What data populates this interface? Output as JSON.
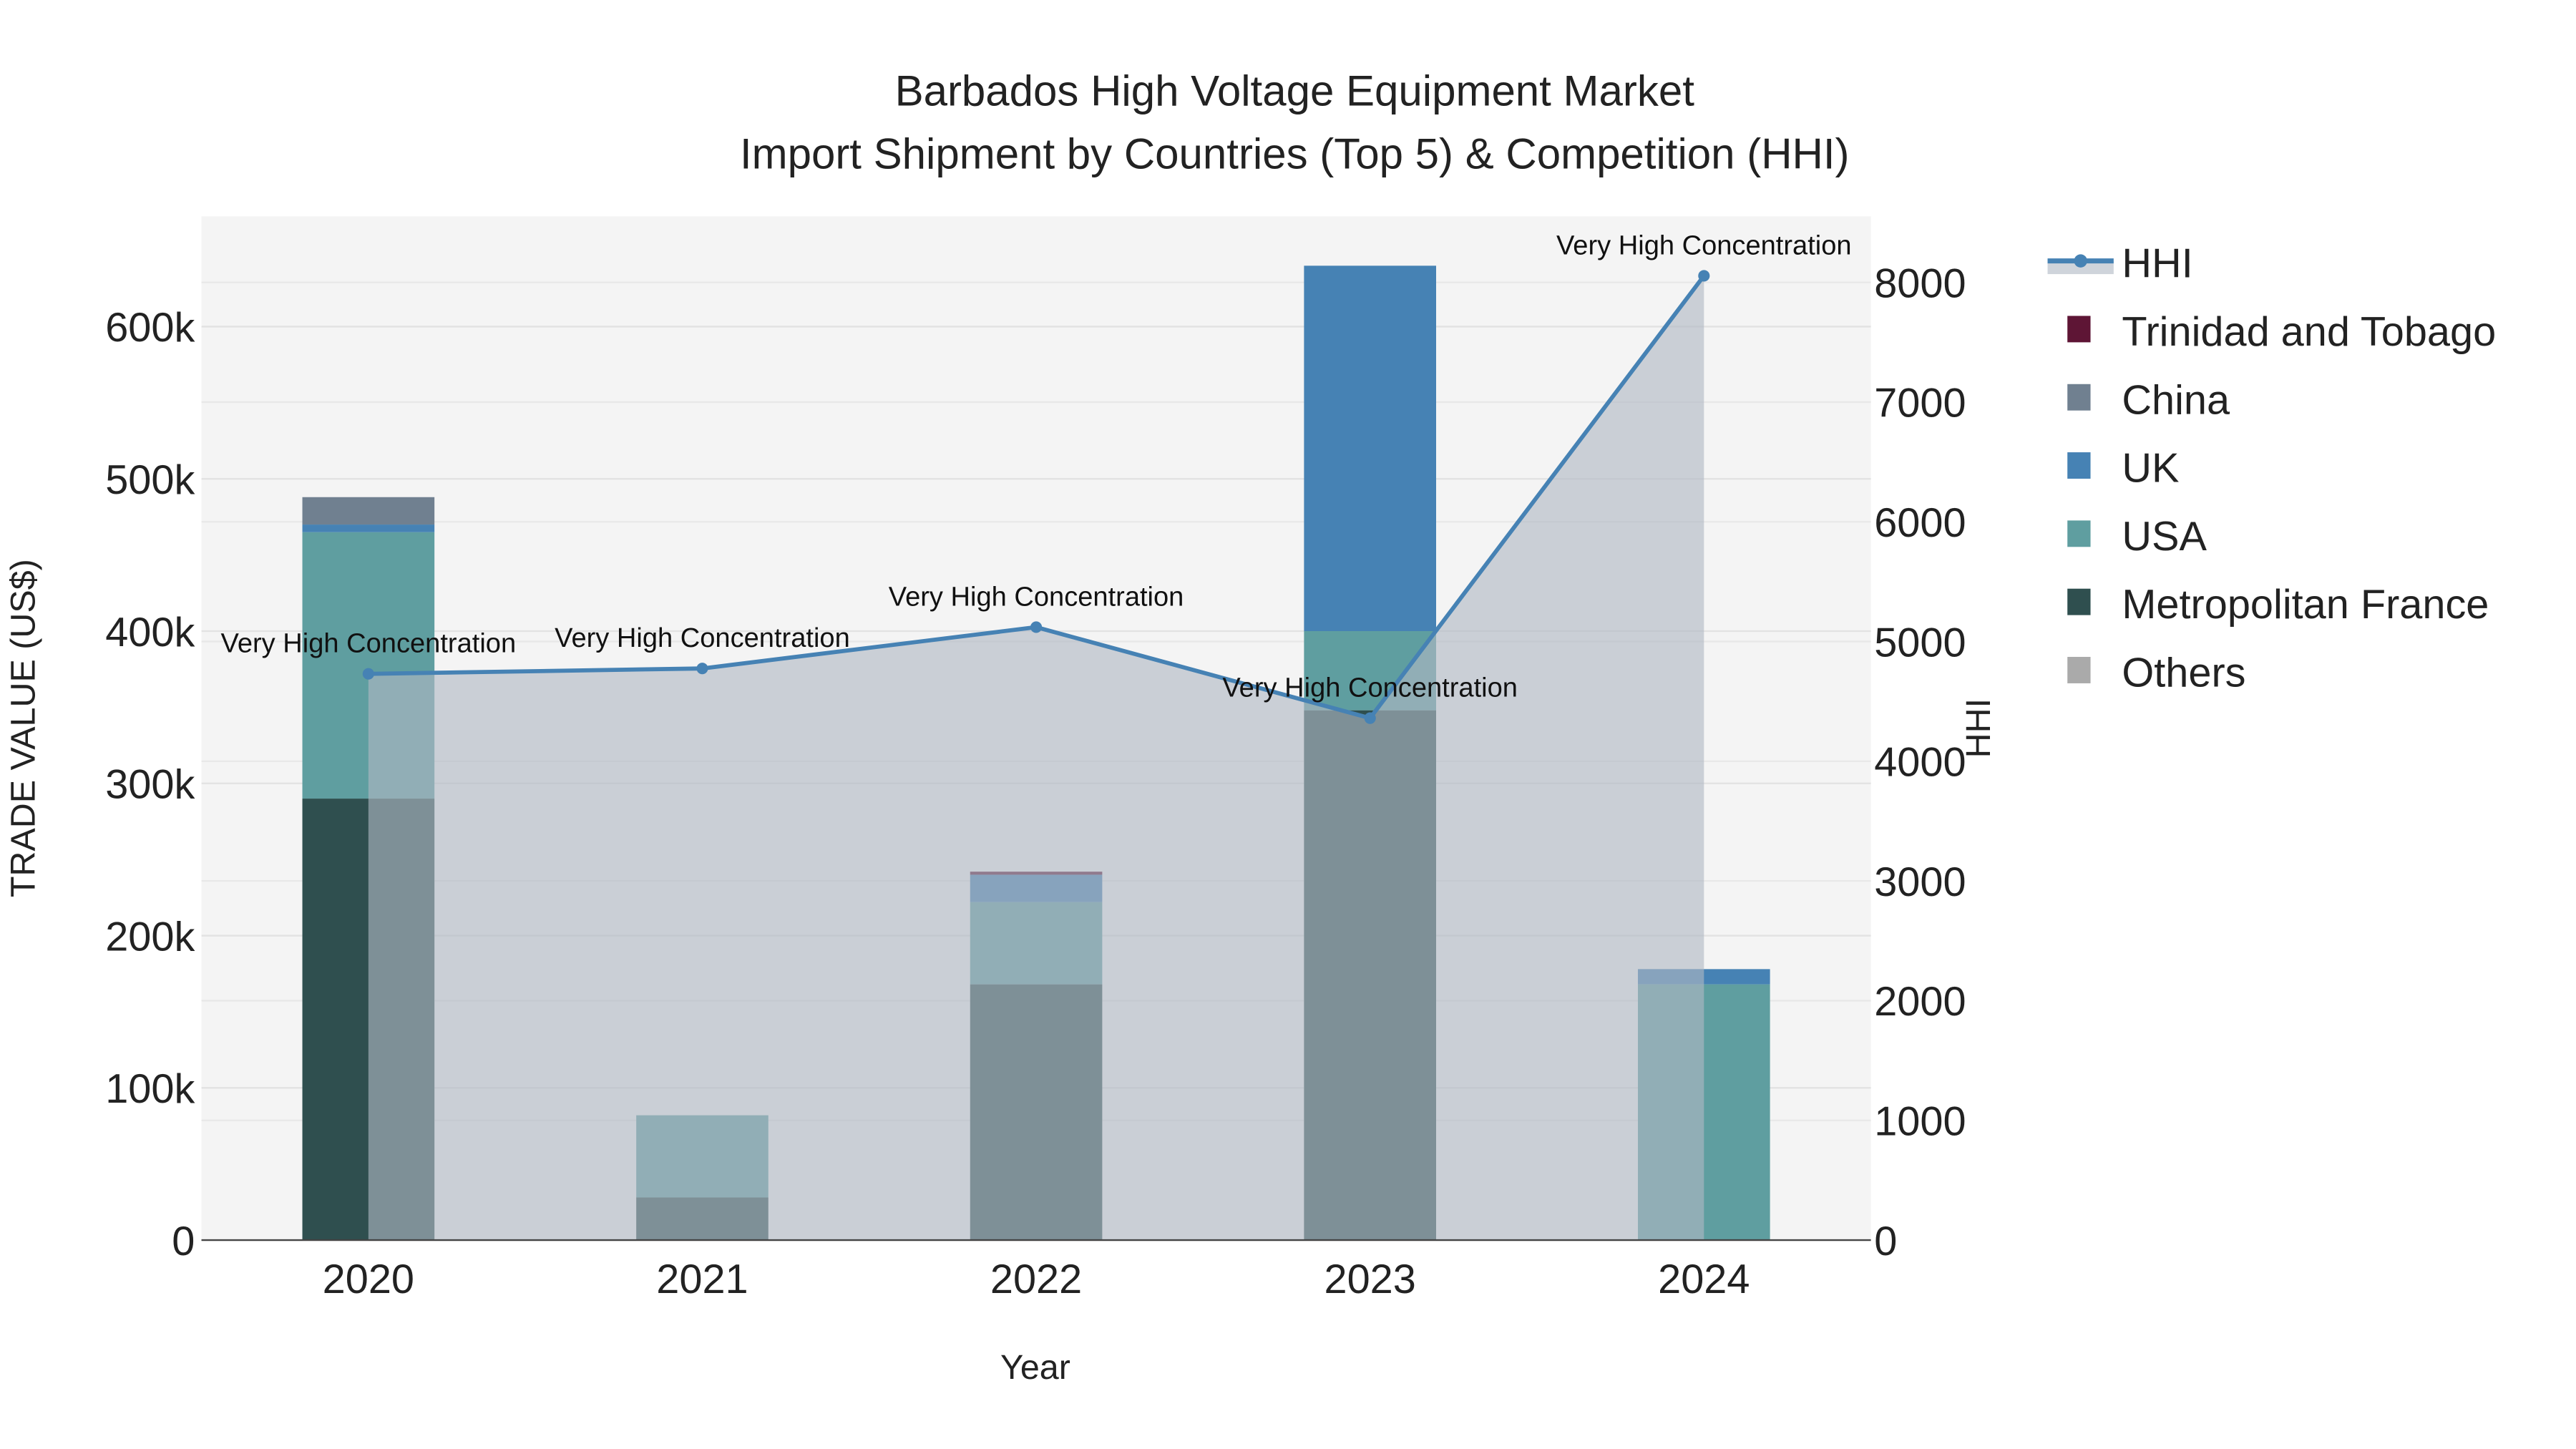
{
  "chart_data": {
    "type": "bar",
    "title": "Barbados High Voltage Equipment Market",
    "subtitle": "Import Shipment by Countries (Top 5) & Competition (HHI)",
    "xlabel": "Year",
    "ylabel": "TRADE VALUE (US$)",
    "y2label": "HHI",
    "categories": [
      "2020",
      "2021",
      "2022",
      "2023",
      "2024"
    ],
    "ylim": [
      0,
      670000
    ],
    "y_ticks": [
      0,
      100000,
      200000,
      300000,
      400000,
      500000,
      600000
    ],
    "y_tick_labels": [
      "0",
      "100k",
      "200k",
      "300k",
      "400k",
      "500k",
      "600k"
    ],
    "y2lim": [
      0,
      8550
    ],
    "y2_ticks": [
      0,
      1000,
      2000,
      3000,
      4000,
      5000,
      6000,
      7000,
      8000
    ],
    "y2_tick_labels": [
      "0",
      "1000",
      "2000",
      "3000",
      "4000",
      "5000",
      "6000",
      "7000",
      "8000"
    ],
    "stacked": true,
    "series": [
      {
        "name": "Metropolitan France",
        "color": "#2f4f4f",
        "values": [
          290000,
          28000,
          168000,
          348000,
          0
        ]
      },
      {
        "name": "USA",
        "color": "#5f9ea0",
        "values": [
          175000,
          54000,
          54000,
          52000,
          168000
        ]
      },
      {
        "name": "UK",
        "color": "#4682b4",
        "values": [
          5000,
          0,
          18000,
          240000,
          10000
        ]
      },
      {
        "name": "China",
        "color": "#708090",
        "values": [
          18000,
          0,
          0,
          0,
          0
        ]
      },
      {
        "name": "Trinidad and Tobago",
        "color": "#5e1535",
        "values": [
          0,
          0,
          2000,
          0,
          0
        ]
      },
      {
        "name": "Others",
        "color": "#aaaaaa",
        "values": [
          0,
          0,
          0,
          0,
          0
        ]
      }
    ],
    "hhi": {
      "name": "HHI",
      "color": "#4682b4",
      "values": [
        4730,
        4775,
        5120,
        4360,
        8055
      ],
      "annotations": [
        "Very High Concentration",
        "Very High Concentration",
        "Very High Concentration",
        "Very High Concentration",
        "Very High Concentration"
      ]
    },
    "legend": [
      "HHI",
      "Trinidad and Tobago",
      "China",
      "UK",
      "USA",
      "Metropolitan France",
      "Others"
    ],
    "legend_placement": "right",
    "grid": true
  }
}
